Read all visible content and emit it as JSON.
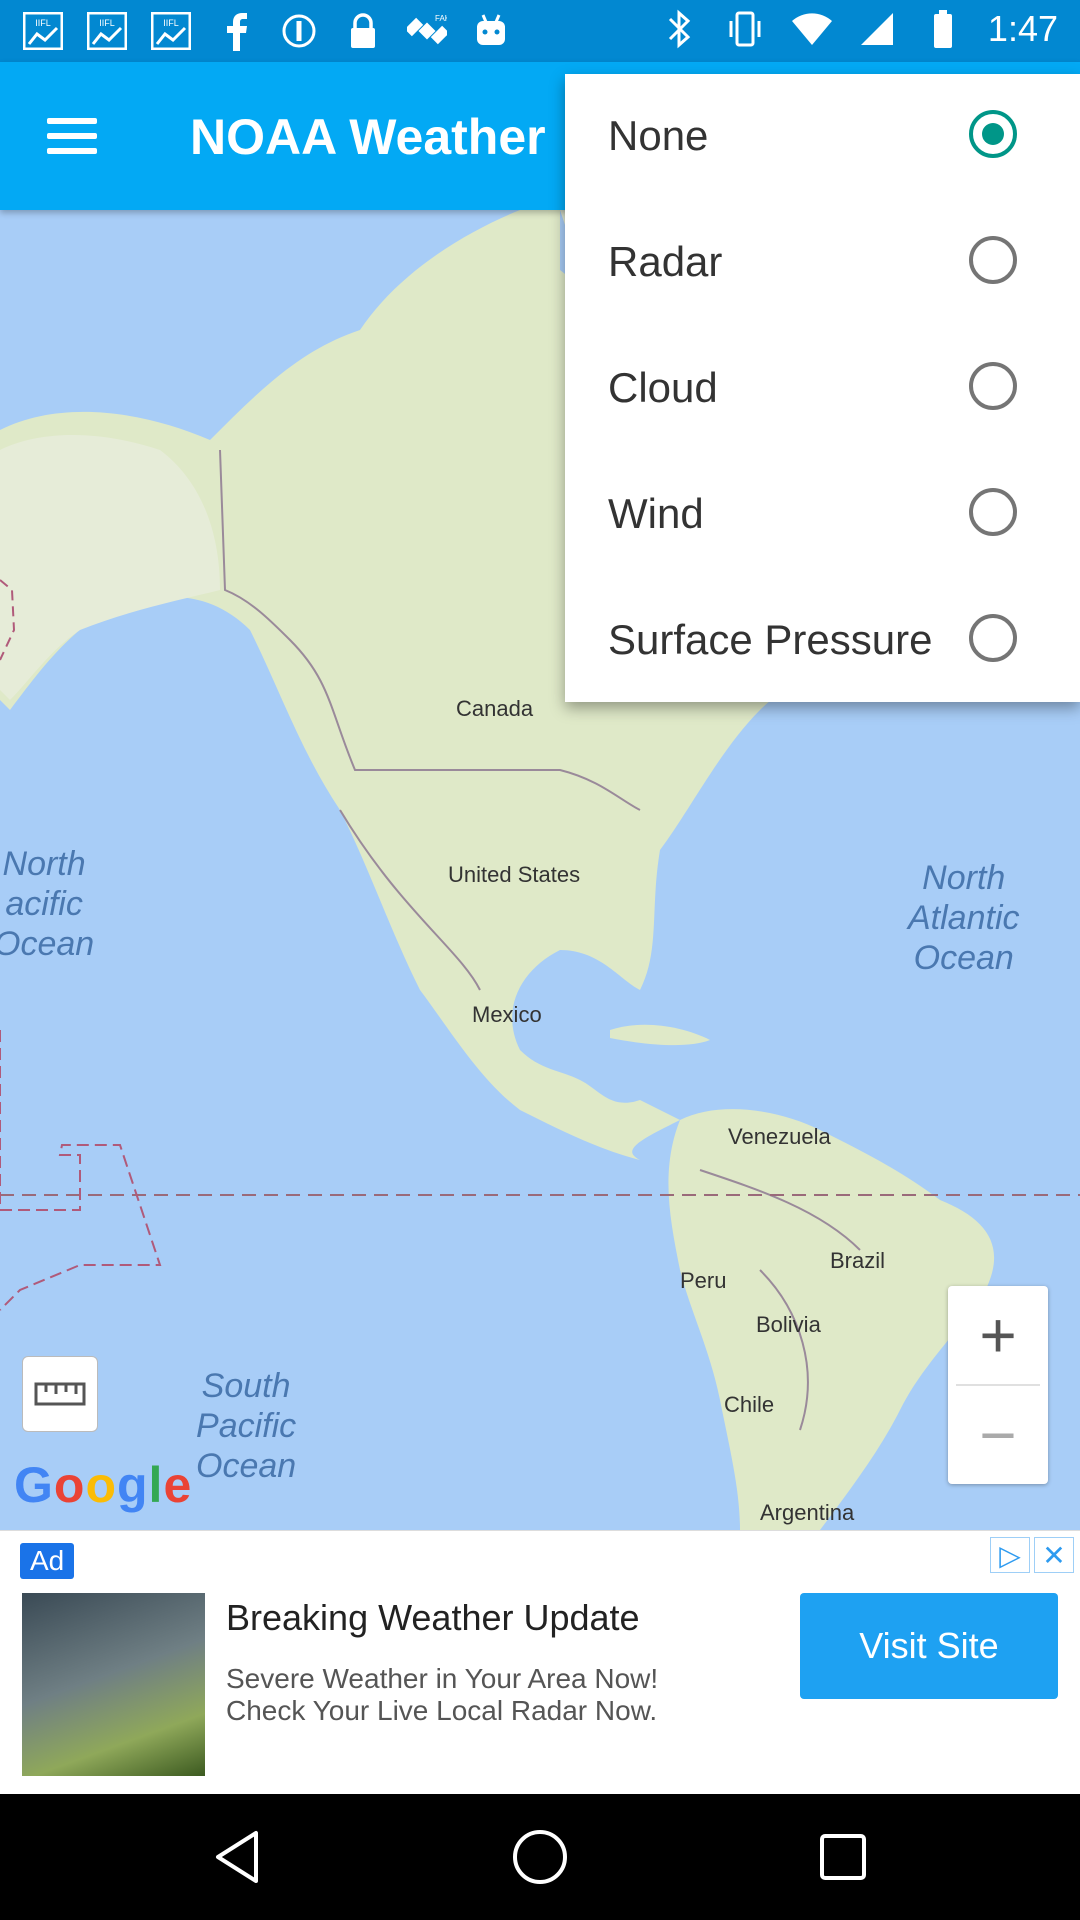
{
  "status_bar": {
    "time": "1:47",
    "left_icons": [
      "markets-icon",
      "markets-icon",
      "markets-icon",
      "facebook-icon",
      "info-icon",
      "lock-icon",
      "satellite-icon",
      "android-icon"
    ],
    "right_icons": [
      "bluetooth-icon",
      "vibrate-icon",
      "wifi-icon",
      "signal-icon",
      "battery-icon"
    ]
  },
  "app_bar": {
    "title": "NOAA Weather"
  },
  "layer_menu": {
    "items": [
      {
        "label": "None",
        "selected": true
      },
      {
        "label": "Radar",
        "selected": false
      },
      {
        "label": "Cloud",
        "selected": false
      },
      {
        "label": "Wind",
        "selected": false
      },
      {
        "label": "Surface Pressure",
        "selected": false
      }
    ]
  },
  "map": {
    "labels": {
      "canada": "Canada",
      "united_states": "United States",
      "mexico": "Mexico",
      "venezuela": "Venezuela",
      "brazil": "Brazil",
      "peru": "Peru",
      "bolivia": "Bolivia",
      "chile": "Chile",
      "argentina": "Argentina"
    },
    "oceans": {
      "north_pacific": "North\nacific\nOcean",
      "north_atlantic": "North\nAtlantic\nOcean",
      "south_pacific": "South\nPacific\nOcean"
    },
    "google_logo": "Google",
    "zoom_in": "+",
    "zoom_out": "−"
  },
  "ad": {
    "badge": "Ad",
    "title": "Breaking Weather Update",
    "description": "Severe Weather in Your Area Now! Check Your Live Local Radar Now.",
    "cta": "Visit Site"
  },
  "colors": {
    "status_bar": "#0288d1",
    "app_bar": "#03a9f4",
    "radio_selected": "#009688",
    "ocean": "#a8cdf7",
    "land": "#dfe9c8",
    "ad_button": "#1ea1f2"
  }
}
